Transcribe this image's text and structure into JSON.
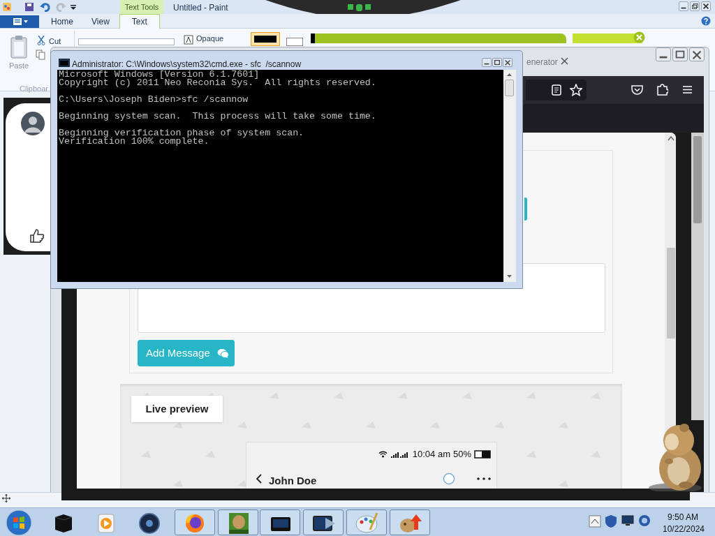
{
  "paint": {
    "title": "Untitled - Paint",
    "context_tab": "Text Tools",
    "tabs": [
      {
        "label": "Home",
        "selected": false
      },
      {
        "label": "View",
        "selected": false
      },
      {
        "label": "Text",
        "selected": true
      }
    ],
    "ribbon": {
      "paste": "Paste",
      "cut": "Cut",
      "opaque": "Opaque",
      "group": "Clipboar"
    }
  },
  "cmd": {
    "title": "Administrator: C:\\Windows\\system32\\cmd.exe - sfc  /scannow",
    "blocks": [
      [
        "Microsoft Windows [Version 6.1.7601]",
        "Copyright (c) 2011 Neo Reconia Sys.  All rights reserved."
      ],
      [
        "C:\\Users\\Joseph Biden>sfc /scannow"
      ],
      [
        "Beginning system scan.  This process will take some time."
      ],
      [
        "Beginning verification phase of system scan.",
        "Verification 100% complete."
      ]
    ]
  },
  "browser": {
    "tab_title": "enerator",
    "page": {
      "add_button": "Add Message",
      "preview_label": "Live preview",
      "phone": {
        "time": "10:04 am",
        "battery": "50%",
        "contact": "John Doe"
      }
    }
  },
  "taskbar": {
    "time": "9:50 AM",
    "date": "10/22/2024"
  }
}
